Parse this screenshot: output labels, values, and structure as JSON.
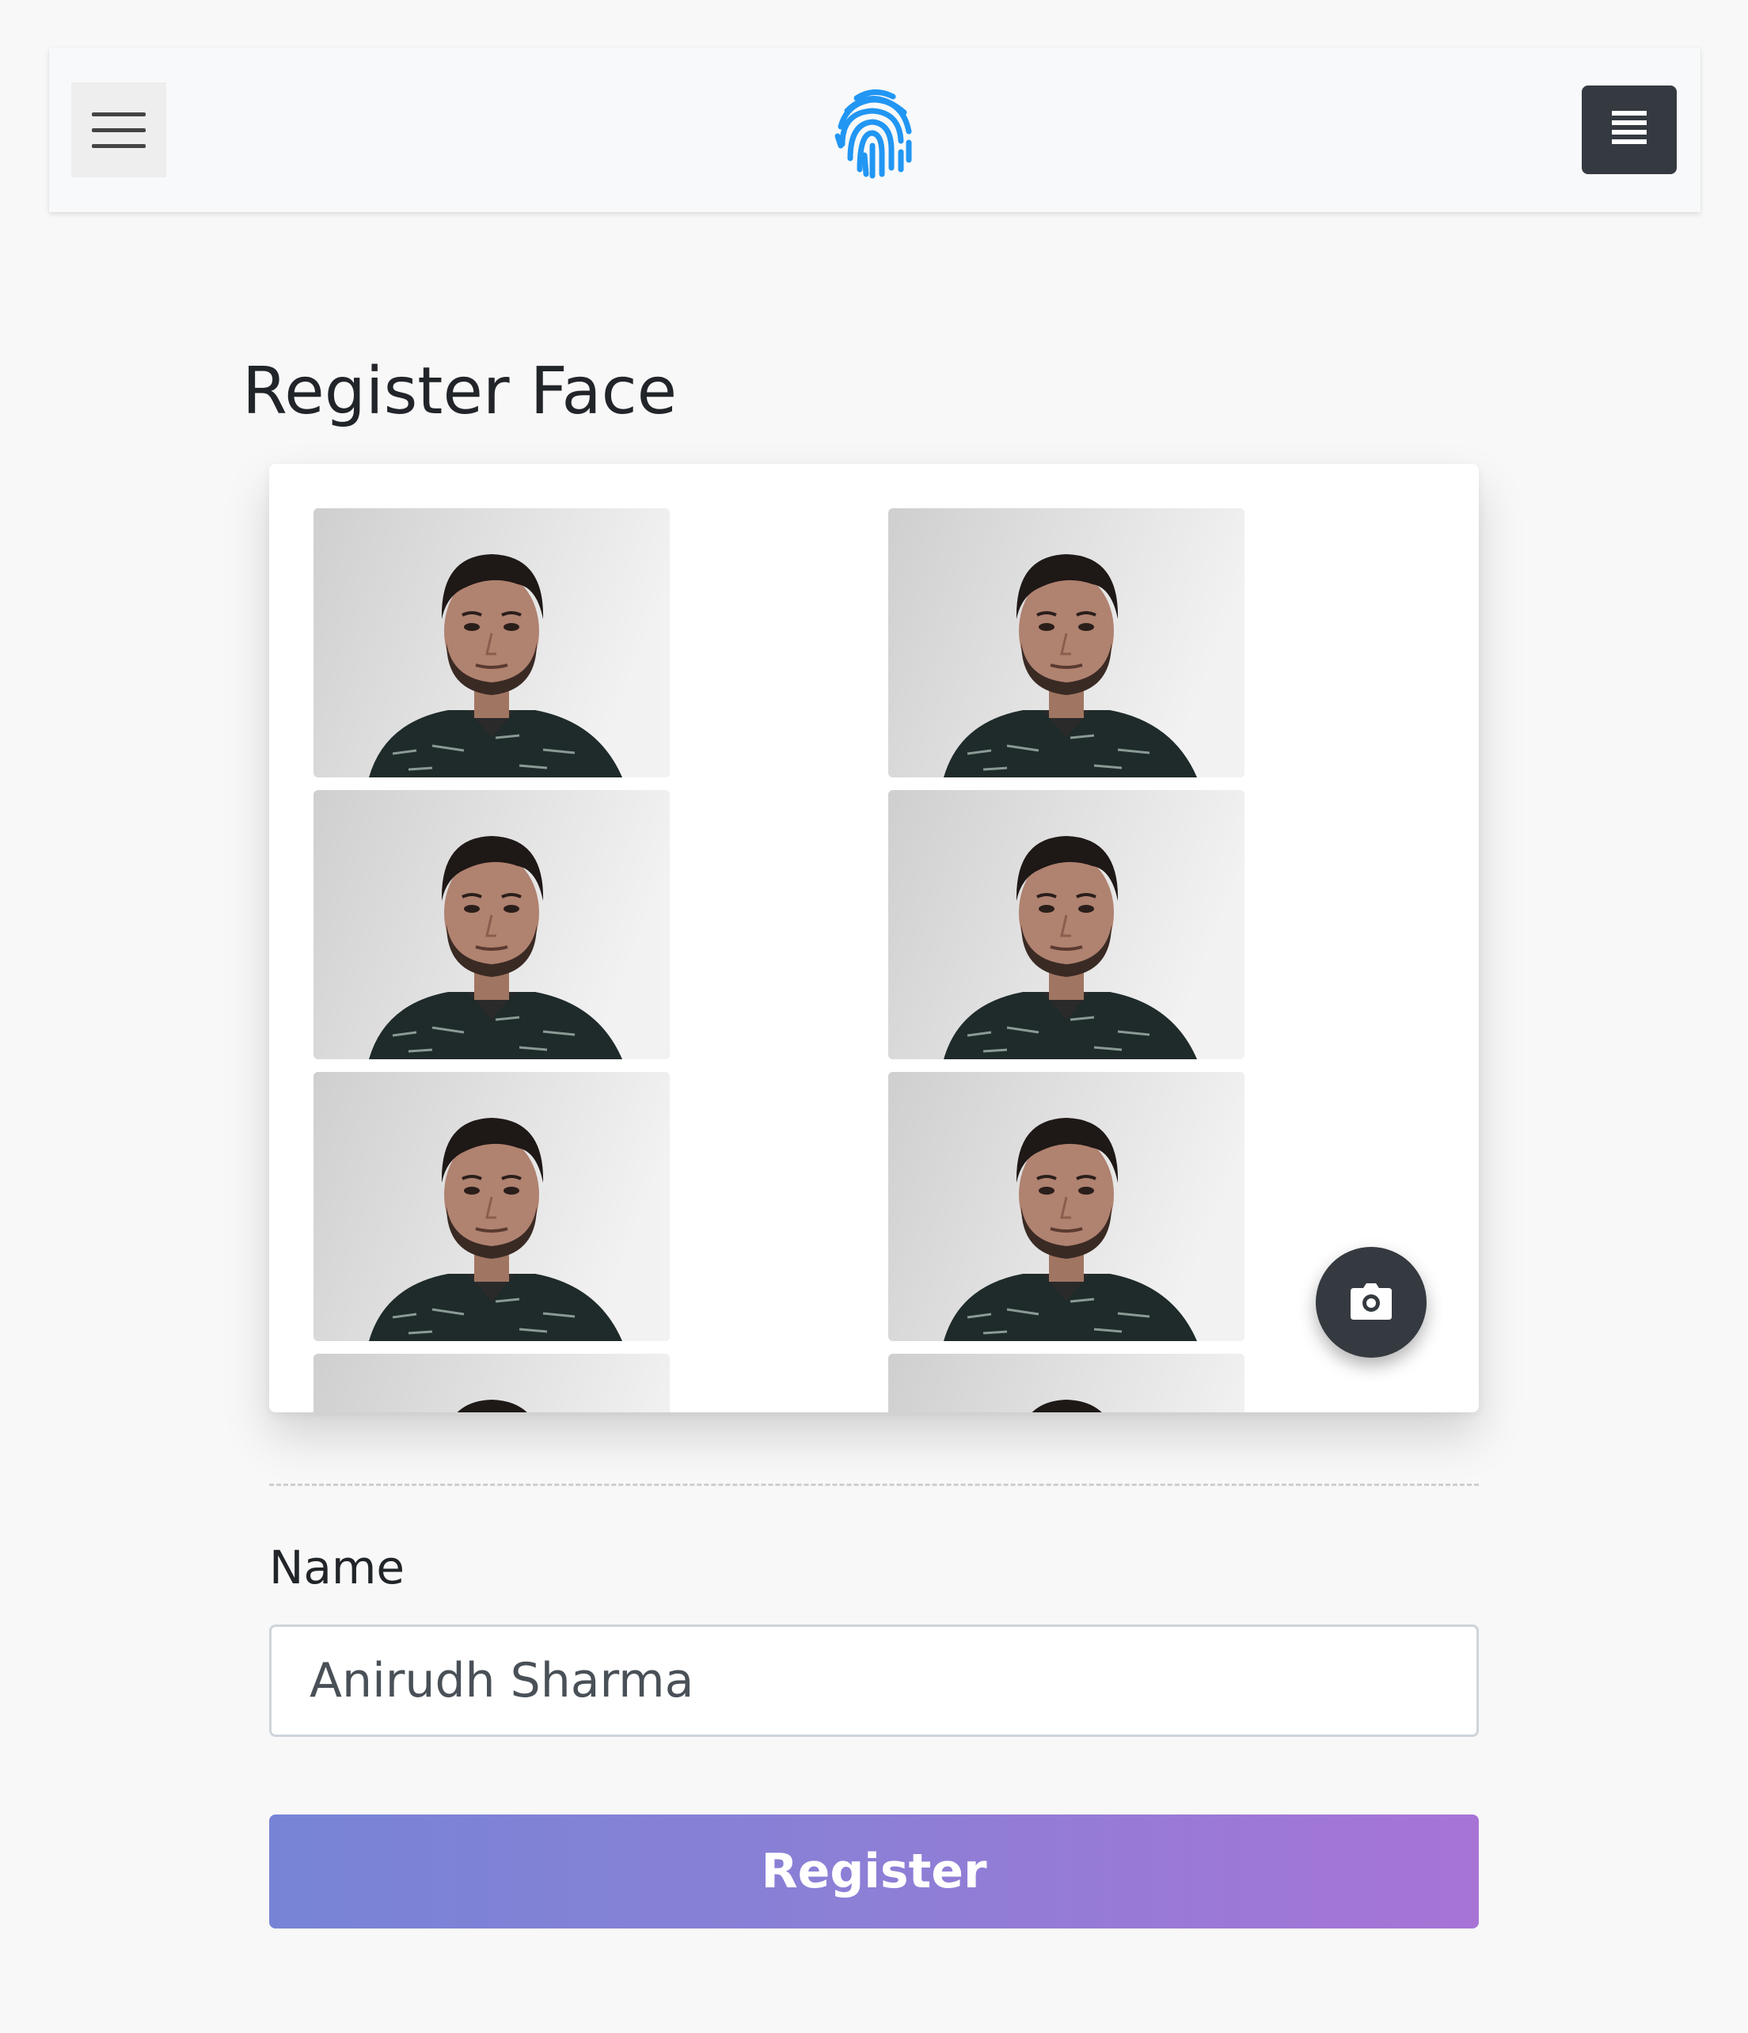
{
  "navbar": {
    "menu_toggle_icon": "hamburger-icon",
    "logo_icon": "fingerprint-icon",
    "logo_color": "#2196f3",
    "options_icon": "list-icon",
    "options_button_color": "#343a40"
  },
  "page": {
    "title": "Register Face"
  },
  "capture": {
    "camera_icon": "camera-icon",
    "camera_button_color": "#343a40"
  },
  "form": {
    "name_label": "Name",
    "name_value": "Anirudh Sharma",
    "register_label": "Register",
    "register_gradient": [
      "#7784d6",
      "#a774d6"
    ]
  }
}
